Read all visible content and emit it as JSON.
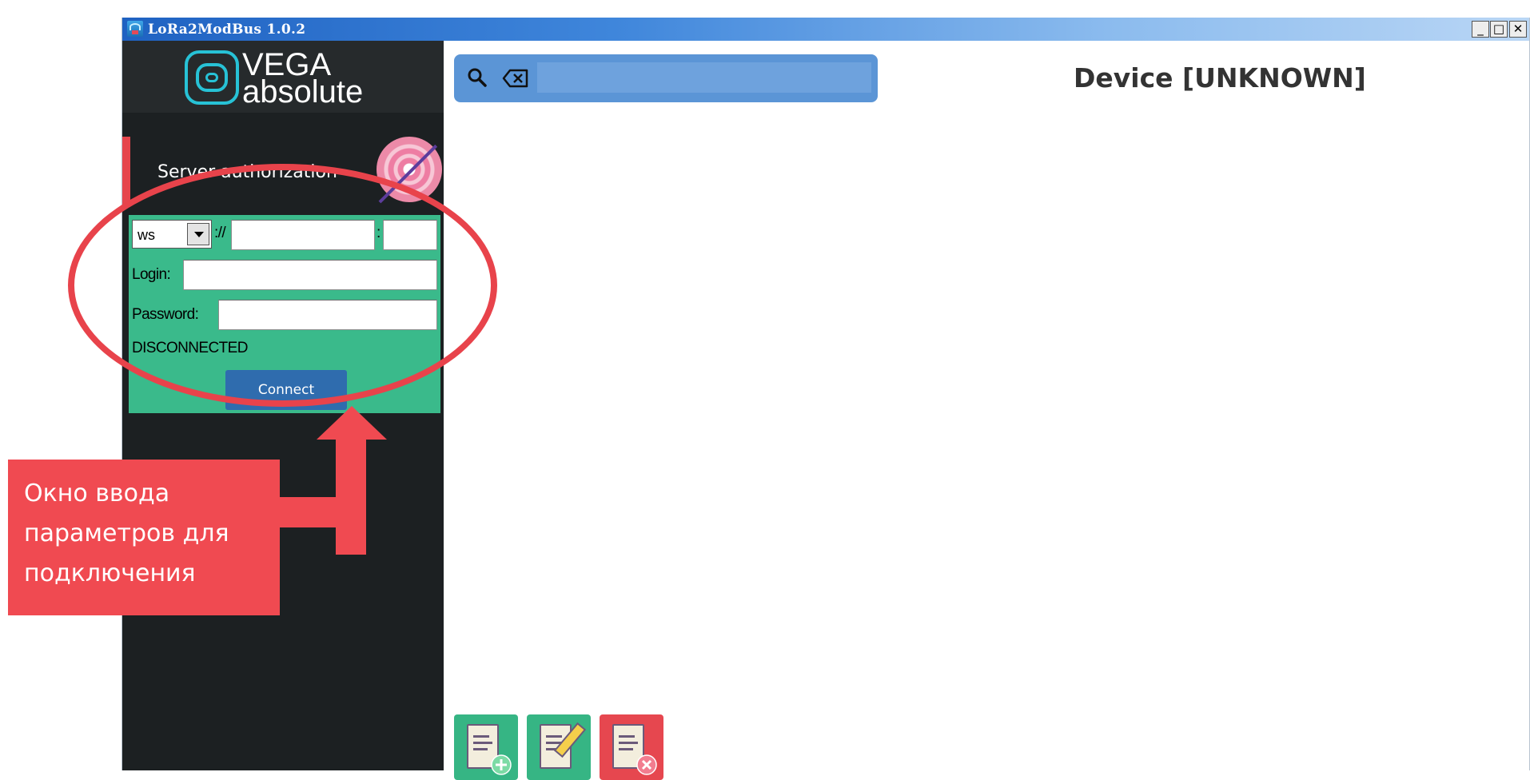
{
  "window": {
    "title": "LoRa2ModBus 1.0.2",
    "controls": {
      "minimize": "_",
      "maximize": "□",
      "close": "✕"
    }
  },
  "logo": {
    "line1": "VEGA",
    "line2": "absolute"
  },
  "auth": {
    "header_label": "Server authorization",
    "scheme_value": "ws",
    "scheme_separator": "://",
    "host_value": "",
    "port_separator": ":",
    "port_value": "",
    "login_label": "Login:",
    "login_value": "",
    "password_label": "Password:",
    "password_value": "",
    "status": "DISCONNECTED",
    "connect_label": "Connect"
  },
  "search": {
    "value": ""
  },
  "device_title": "Device [UNKNOWN]",
  "toolbar": [
    "add-document",
    "edit-document",
    "delete-document"
  ],
  "annotation": {
    "lines": [
      "Окно ввода",
      "параметров для",
      "подключения"
    ],
    "color": "#f04a51"
  },
  "colors": {
    "accent_green": "#3aba8b",
    "button_blue": "#2f6cae",
    "sidebar": "#1c2022",
    "alert_red": "#e6474f"
  }
}
